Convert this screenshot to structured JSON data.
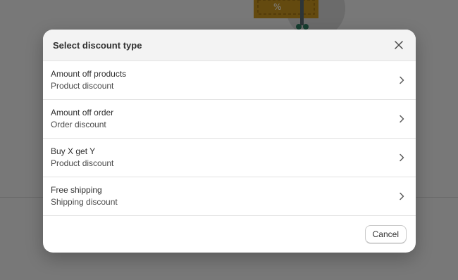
{
  "modal": {
    "title": "Select discount type",
    "close_icon": "close-icon",
    "options": [
      {
        "title": "Amount off products",
        "subtitle": "Product discount"
      },
      {
        "title": "Amount off order",
        "subtitle": "Order discount"
      },
      {
        "title": "Buy X get Y",
        "subtitle": "Product discount"
      },
      {
        "title": "Free shipping",
        "subtitle": "Shipping discount"
      }
    ],
    "cancel_label": "Cancel"
  },
  "colors": {
    "overlay": "#8a8a8a",
    "header_bg": "#f3f3f3",
    "text_primary": "#303030",
    "illustration_accent": "#c8941e"
  }
}
